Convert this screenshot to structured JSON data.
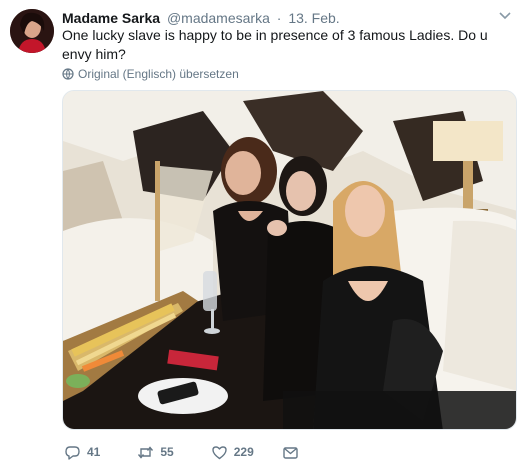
{
  "tweet": {
    "display_name": "Madame Sarka",
    "handle": "@madamesarka",
    "separator": "·",
    "date": "13. Feb.",
    "text": "One lucky slave is happy to be in presence of 3 famous Ladies. Do u envy him?",
    "translate_label": "Original (Englisch) übersetzen"
  },
  "actions": {
    "reply_count": "41",
    "retweet_count": "55",
    "like_count": "229"
  },
  "icons": {
    "caret": "chevron-down-icon",
    "translate": "globe-icon",
    "reply": "reply-icon",
    "retweet": "retweet-icon",
    "like": "heart-icon",
    "dm": "envelope-icon"
  },
  "colors": {
    "text": "#14171a",
    "muted": "#657786"
  }
}
